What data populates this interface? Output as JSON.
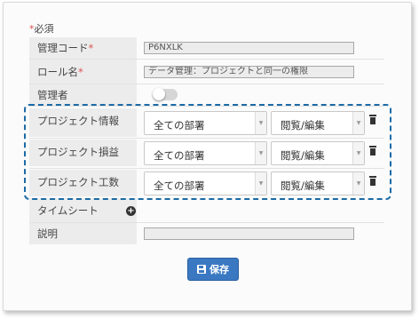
{
  "required_note": {
    "star": "*",
    "text": "必須"
  },
  "fields": {
    "code": {
      "label": "管理コード",
      "star": "*",
      "value": "P6NXLK"
    },
    "role": {
      "label": "ロール名",
      "star": "*",
      "value": "データ管理：プロジェクトと同一の権限"
    },
    "admin": {
      "label": "管理者",
      "state": "off"
    }
  },
  "permissions": [
    {
      "label": "プロジェクト情報",
      "dept": "全ての部署",
      "access": "閲覧/編集"
    },
    {
      "label": "プロジェクト損益",
      "dept": "全ての部署",
      "access": "閲覧/編集"
    },
    {
      "label": "プロジェクト工数",
      "dept": "全ての部署",
      "access": "閲覧/編集"
    }
  ],
  "timesheet": {
    "label": "タイムシート",
    "add_icon": "plus-circle-icon"
  },
  "description": {
    "label": "説明",
    "value": ""
  },
  "save": {
    "label": "保存",
    "icon": "floppy-disk-icon"
  },
  "colors": {
    "accent": "#3a78c2",
    "highlight": "#1c6aa6",
    "required": "#d9534f"
  }
}
